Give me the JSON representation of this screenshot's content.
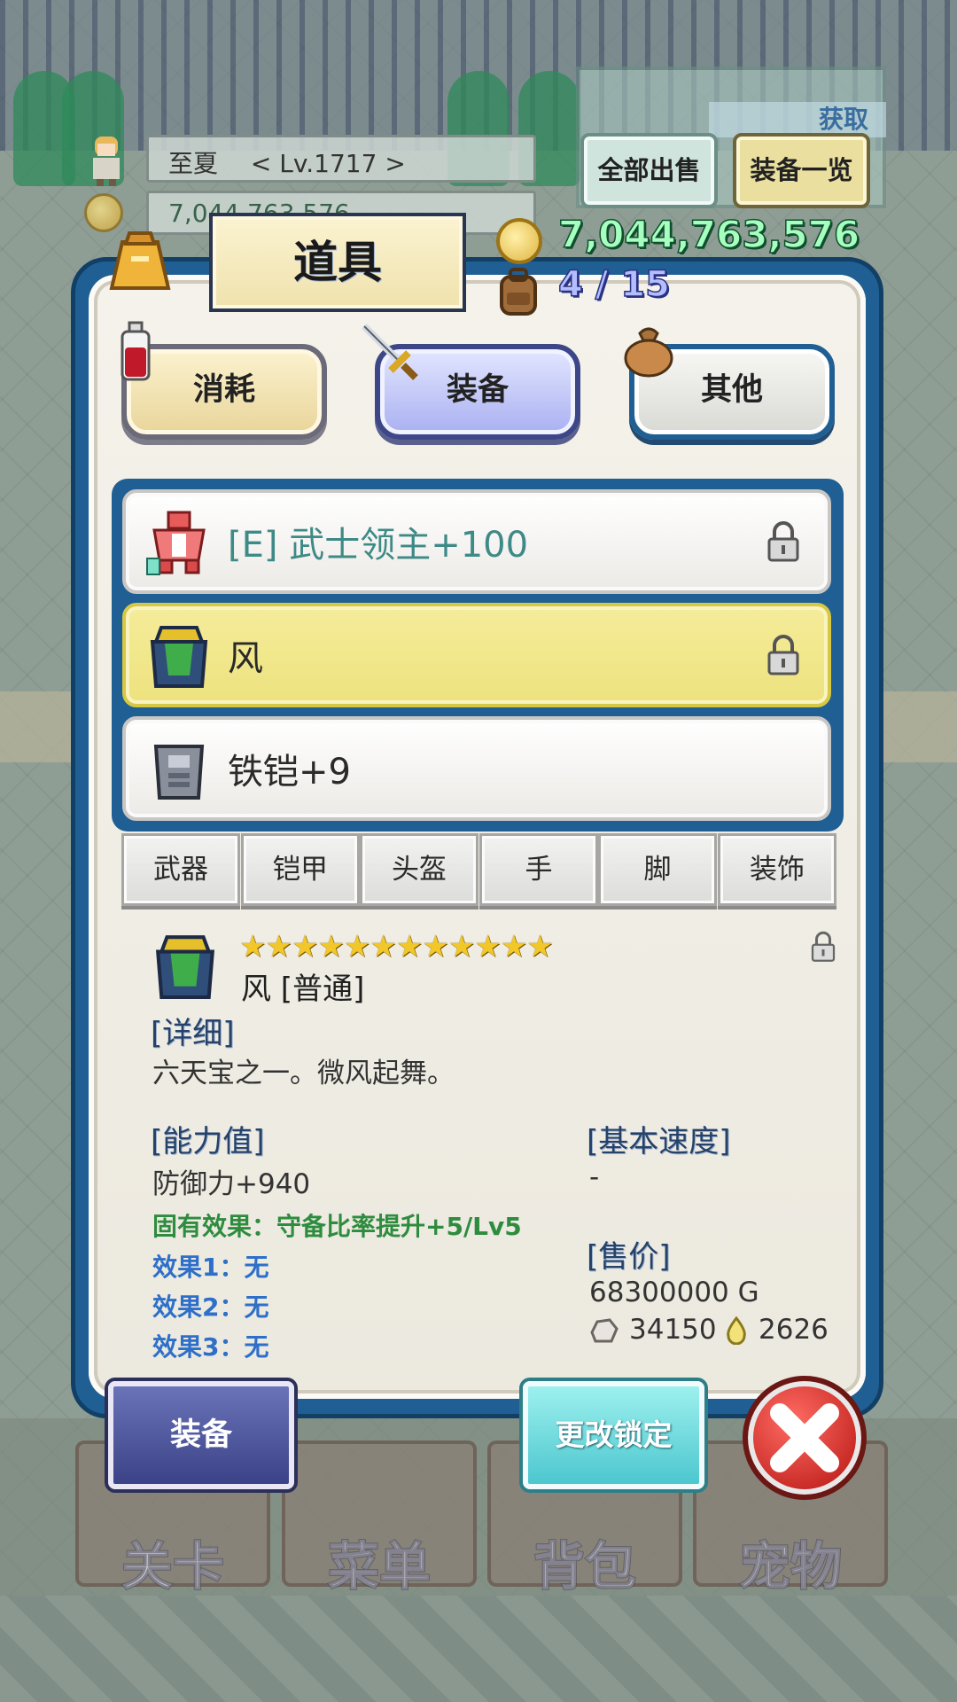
{
  "hud": {
    "player_name": "至夏",
    "player_level": "< Lv.1717 >",
    "gold_faded": "7,044,763,576",
    "get_label": "获取",
    "sell_all_label": "全部出售",
    "equip_list_label": "装备一览"
  },
  "panel": {
    "title": "道具",
    "gold": "7,044,763,576",
    "capacity": "4 / 15"
  },
  "categories": [
    {
      "label": "消耗",
      "icon": "potion-icon"
    },
    {
      "label": "装备",
      "icon": "sword-icon",
      "selected": true
    },
    {
      "label": "其他",
      "icon": "sack-icon"
    }
  ],
  "items": [
    {
      "name": "[E] 武士领主+100",
      "equipped": true,
      "locked": true,
      "icon": "red-armor-icon"
    },
    {
      "name": "风",
      "equipped": false,
      "locked": true,
      "selected": true,
      "icon": "green-armor-icon"
    },
    {
      "name": "铁铠+9",
      "equipped": false,
      "locked": false,
      "icon": "iron-armor-icon"
    }
  ],
  "type_tabs": [
    "武器",
    "铠甲",
    "头盔",
    "手",
    "脚",
    "装饰"
  ],
  "detail": {
    "stars": "★★★★★★★★★★★★",
    "star_count": 12,
    "name": "风 [普通]",
    "detail_title": "[详细]",
    "description": "六天宝之一。微风起舞。",
    "stats_title": "[能力值]",
    "defense": "防御力+940",
    "inherent_effect": "固有效果：守备比率提升+5/Lv5",
    "effect1": "效果1：无",
    "effect2": "效果2：无",
    "effect3": "效果3：无",
    "speed_title": "[基本速度]",
    "speed_value": "-",
    "price_title": "[售价]",
    "price_gold": "68300000 G",
    "price_ore": "34150",
    "price_drop": "2626"
  },
  "buttons": {
    "equip": "装备",
    "change_lock": "更改锁定"
  },
  "nav": [
    "关卡",
    "菜单",
    "背包",
    "宠物"
  ],
  "colors": {
    "panel_blue": "#1f5f93",
    "selected_row": "#f3e98d",
    "gold_text": "#a7ffbf",
    "capacity_text": "#b3bdff",
    "equipped_text": "#3e8a86",
    "effect_green": "#2e8c3f",
    "effect_blue": "#2d6fc9"
  }
}
